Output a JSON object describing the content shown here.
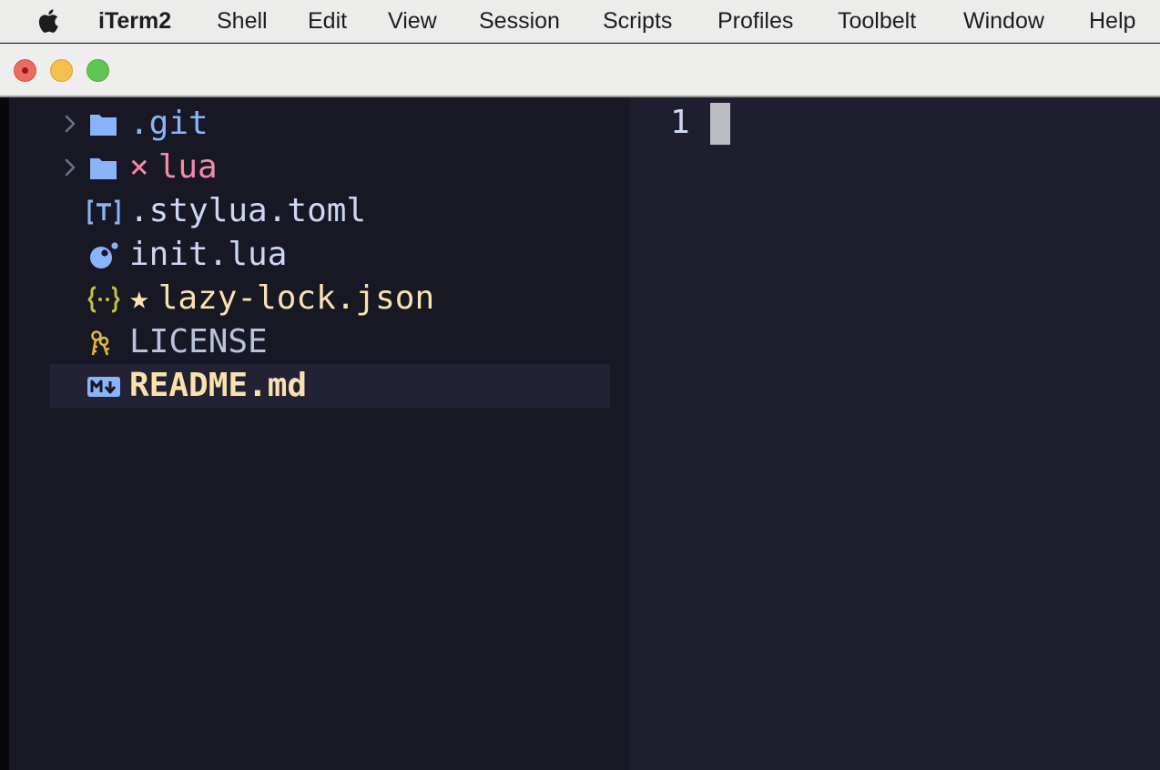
{
  "menubar": {
    "app_name": "iTerm2",
    "items": [
      "Shell",
      "Edit",
      "View",
      "Session",
      "Scripts",
      "Profiles",
      "Toolbelt",
      "Window",
      "Help"
    ]
  },
  "file_tree": {
    "entries": [
      {
        "name": ".git",
        "kind": "folder",
        "icon": "folder-icon",
        "color": "#89b4fa"
      },
      {
        "name": "lua",
        "status_symbol": "×",
        "kind": "folder",
        "icon": "folder-icon",
        "color": "#f38ba8"
      },
      {
        "name": ".stylua.toml",
        "kind": "file",
        "icon": "toml-icon",
        "color": "#cdd6f4"
      },
      {
        "name": "init.lua",
        "kind": "file",
        "icon": "lua-icon",
        "color": "#cdd6f4"
      },
      {
        "name": "lazy-lock.json",
        "status_symbol": "★",
        "kind": "file",
        "icon": "json-icon",
        "color": "#f9e2af"
      },
      {
        "name": "LICENSE",
        "kind": "file",
        "icon": "license-key-icon",
        "color": "#bac2de"
      },
      {
        "name": "README.md",
        "kind": "file",
        "icon": "markdown-icon",
        "color": "#f9e2af",
        "selected": true
      }
    ]
  },
  "editor": {
    "line_number": "1"
  },
  "colors": {
    "tree_background": "#181825",
    "editor_background": "#1e1e2e",
    "folder_icon": "#89b4fa",
    "json_icon": "#c3c33a",
    "key_icon": "#e0b83a"
  }
}
